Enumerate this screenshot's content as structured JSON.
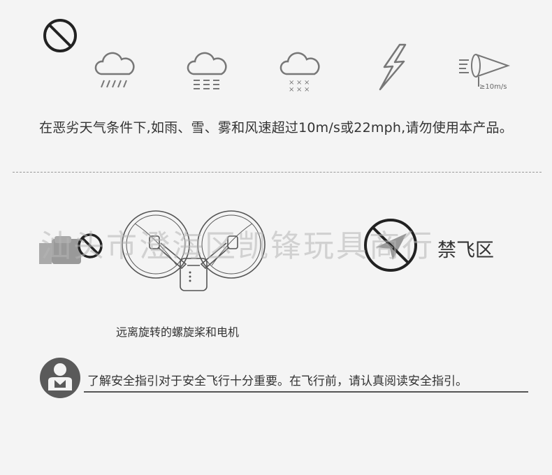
{
  "weather_section": {
    "icons": [
      "prohibited-icon",
      "rain-icon",
      "sleet-icon",
      "snow-icon",
      "lightning-icon",
      "wind-icon"
    ],
    "wind_label": "≥10m/s",
    "warning_text": "在恶劣天气条件下,如雨、雪、雾和风速超过10m/s或22mph,请勿使用本产品。"
  },
  "watermark": "汕头市澄海区凯锋玩具商行",
  "nofly": {
    "label": "禁飞区"
  },
  "propeller": {
    "caption": "远离旋转的螺旋桨和电机"
  },
  "guide": {
    "text": "了解安全指引对于安全飞行十分重要。在飞行前，请认真阅读安全指引。"
  },
  "colors": {
    "icon_stroke": "#333333",
    "light_icon": "#888888",
    "text": "#333333",
    "watermark": "#b4b4b4"
  }
}
